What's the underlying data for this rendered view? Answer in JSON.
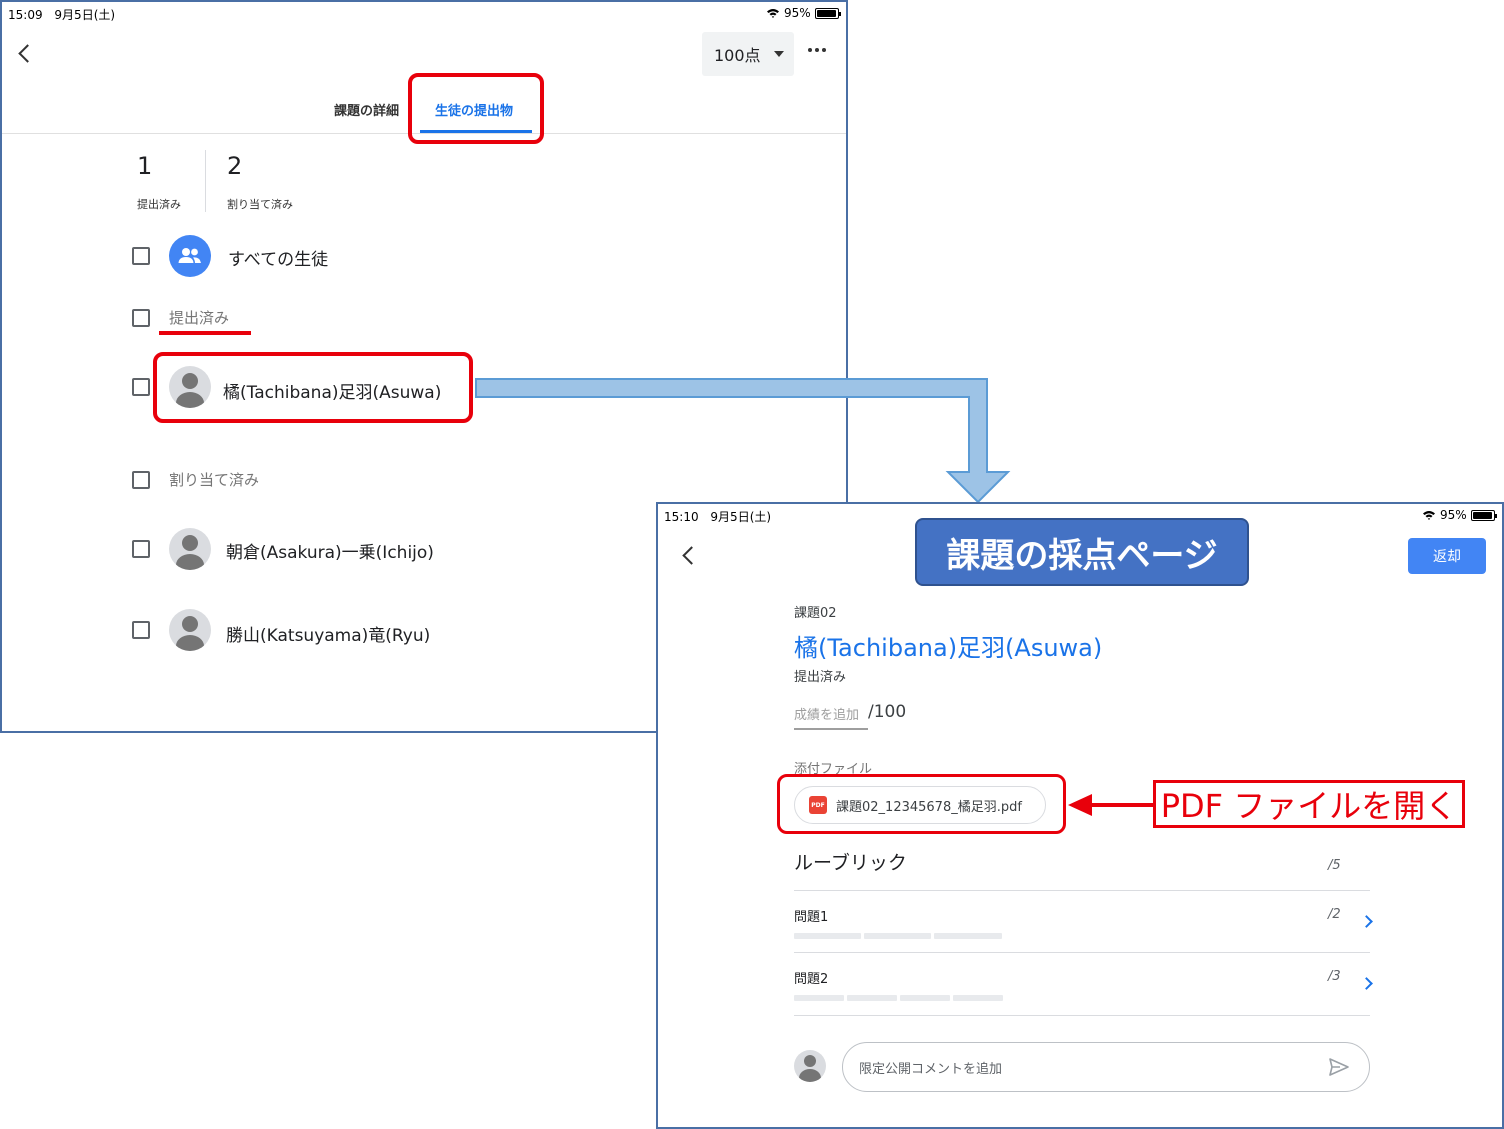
{
  "screen1": {
    "status": {
      "time": "15:09",
      "date": "9月5日(土)",
      "battery": "95%",
      "battery_level": 0.95
    },
    "points_select": "100点",
    "tabs": [
      {
        "label": "課題の詳細"
      },
      {
        "label": "生徒の提出物"
      }
    ],
    "counts": [
      {
        "number": "1",
        "label": "提出済み"
      },
      {
        "number": "2",
        "label": "割り当て済み"
      }
    ],
    "all_students": "すべての生徒",
    "sections": {
      "submitted": "提出済み",
      "assigned": "割り当て済み"
    },
    "students": [
      {
        "name": "橘(Tachibana)足羽(Asuwa)"
      },
      {
        "name": "朝倉(Asakura)一乗(Ichijo)"
      },
      {
        "name": "勝山(Katsuyama)竜(Ryu)"
      }
    ]
  },
  "screen2": {
    "status": {
      "time": "15:10",
      "date": "9月5日(土)",
      "battery": "95%",
      "battery_level": 0.95
    },
    "title_banner": "課題の採点ページ",
    "return_button": "返却",
    "assignment": "課題02",
    "student_name": "橘(Tachibana)足羽(Asuwa)",
    "status_text": "提出済み",
    "grade_placeholder": "成績を追加",
    "grade_total": "/100",
    "attachments_label": "添付ファイル",
    "attachment": {
      "icon": "PDF",
      "filename": "課題02_12345678_橘足羽.pdf"
    },
    "rubric": {
      "title": "ルーブリック",
      "total": "/5",
      "items": [
        {
          "label": "問題1",
          "score": "/2"
        },
        {
          "label": "問題2",
          "score": "/3"
        }
      ]
    },
    "comment_placeholder": "限定公開コメントを追加"
  },
  "annotation": "PDF ファイルを開く",
  "colors": {
    "accent": "#1a73e8",
    "highlight_red": "#e8000b",
    "banner": "#4472c4",
    "connector": "#9dc3e6"
  }
}
